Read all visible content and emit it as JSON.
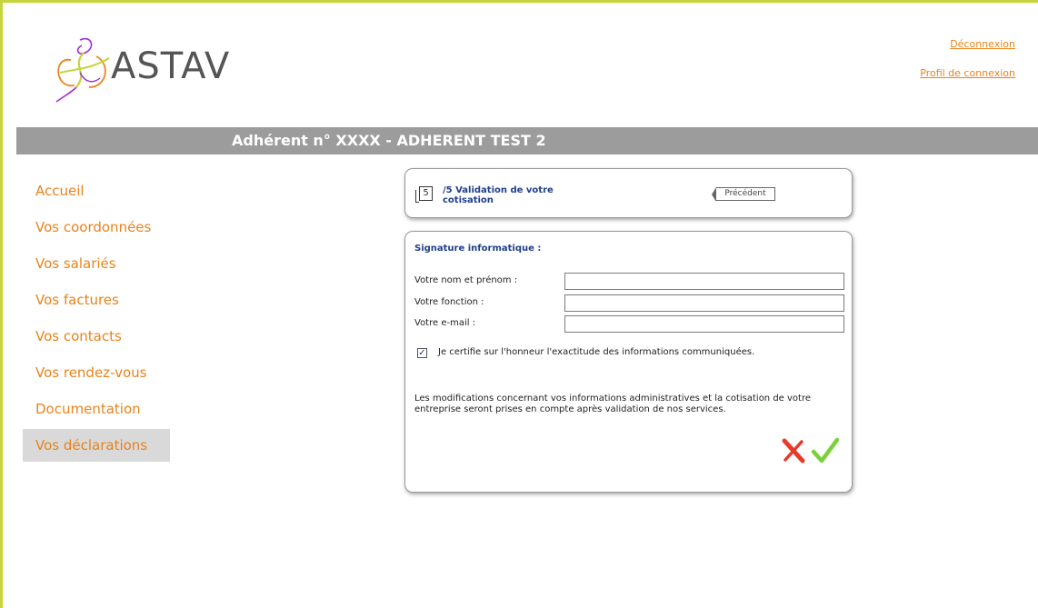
{
  "brand": {
    "name": "ASTAV",
    "colors": {
      "accent": "#e8831c",
      "green": "#c4d43a",
      "purple": "#a52bd8",
      "banner": "#9c9c9c",
      "title_blue": "#1f3f8a"
    }
  },
  "header_links": {
    "logout": "Déconnexion",
    "profile": "Profil de connexion"
  },
  "banner": {
    "title": "Adhérent n°  XXXX - ADHERENT TEST 2"
  },
  "nav": {
    "items": [
      {
        "label": "Accueil"
      },
      {
        "label": "Vos coordonnées"
      },
      {
        "label": "Vos salariés"
      },
      {
        "label": "Vos factures"
      },
      {
        "label": "Vos contacts"
      },
      {
        "label": "Vos rendez-vous"
      },
      {
        "label": "Documentation"
      },
      {
        "label": "Vos déclarations",
        "active": true
      }
    ]
  },
  "step": {
    "number": "5",
    "title": "/5 Validation de votre cotisation",
    "prev_label": "Précédent"
  },
  "form": {
    "title": "Signature informatique :",
    "fields": [
      {
        "label": "Votre nom et prénom :",
        "value": ""
      },
      {
        "label": "Votre fonction :",
        "value": ""
      },
      {
        "label": "Votre e-mail :",
        "value": ""
      }
    ],
    "certify": {
      "checked": true,
      "label": "Je certifie sur l'honneur l'exactitude des informations communiquées."
    },
    "notice": "Les modifications concernant vos informations administratives et la cotisation de votre entreprise seront prises en compte après validation de nos services.",
    "actions": {
      "cancel_icon": "red-cross-icon",
      "confirm_icon": "green-check-icon"
    }
  }
}
